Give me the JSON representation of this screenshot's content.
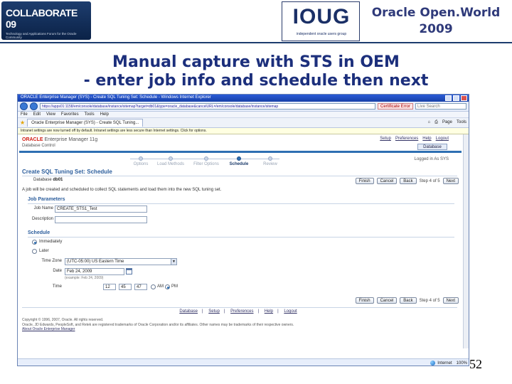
{
  "slide": {
    "title_line1": "Manual capture with STS in OEM",
    "title_line2": "- enter job info and schedule then next",
    "page_number": "52"
  },
  "banner": {
    "collaborate_logo": "COLLABORATE 09",
    "collaborate_tagline": "Technology and Applications Forum for the Oracle Community",
    "ioug_logo": "IOUG",
    "ioug_tagline": "independent oracle users group",
    "event_line1": "Oracle Open.World",
    "event_line2": "2009"
  },
  "browser": {
    "window_title": "ORACLE Enterprise Manager (SYS) - Create SQL Tuning Set: Schedule - Windows Internet Explorer",
    "url": "https://apps01:1158/em/console/database/instance/sitemap?target=db01&type=oracle_database&cancelURL=/em/console/database/instance/sitemap",
    "certificate_label": "Certificate Error",
    "search_placeholder": "Live Search",
    "menu": [
      "File",
      "Edit",
      "View",
      "Favorites",
      "Tools",
      "Help"
    ],
    "tab_label": "Oracle Enterprise Manager (SYS) - Create SQL Tuning...",
    "tools": [
      "Page",
      "Tools"
    ],
    "infobar": "Intranet settings are now turned off by default. Intranet settings are less secure than Internet settings. Click for options.",
    "status_zone": "Internet",
    "zoom": "100%"
  },
  "oem": {
    "brand_oracle": "ORACLE",
    "brand_product": "Enterprise Manager 11g",
    "brand_sub": "Database Control",
    "global_links": [
      "Setup",
      "Preferences",
      "Help",
      "Logout"
    ],
    "db_tab": "Database",
    "train_steps": [
      {
        "label": "Options",
        "current": false
      },
      {
        "label": "Load Methods",
        "current": false
      },
      {
        "label": "Filter Options",
        "current": false
      },
      {
        "label": "Schedule",
        "current": true
      },
      {
        "label": "Review",
        "current": false
      }
    ],
    "logged_in": "Logged in As SYS",
    "page_header": "Create SQL Tuning Set: Schedule",
    "database_label": "Database",
    "database_value": "db01",
    "buttons": {
      "finish": "Finish",
      "cancel": "Cancel",
      "back": "Back",
      "step": "Step 4 of 5",
      "next": "Next"
    },
    "intro": "A job will be created and scheduled to collect SQL statements and load them into the new SQL tuning set.",
    "job_section": "Job Parameters",
    "job_name_label": "Job Name",
    "job_name_value": "CREATE_STS1_Test",
    "description_label": "Description",
    "description_value": "",
    "schedule_section": "Schedule",
    "radio_immediately": "Immediately",
    "radio_later": "Later",
    "timezone_label": "Time Zone",
    "timezone_value": "(UTC-05:00) US Eastern Time",
    "date_label": "Date",
    "date_value": "Feb 24, 2009",
    "date_hint": "(example: Feb 24, 2009)",
    "time_label": "Time",
    "time_hour": "12",
    "time_min": "45",
    "time_sec": "47",
    "time_am": "AM",
    "time_pm": "PM",
    "footer_links": [
      "Database",
      "Setup",
      "Preferences",
      "Help",
      "Logout"
    ],
    "copyright_line1": "Copyright © 1996, 2007, Oracle. All rights reserved.",
    "copyright_line2": "Oracle, JD Edwards, PeopleSoft, and Retek are registered trademarks of Oracle Corporation and/or its affiliates. Other names may be trademarks of their respective owners.",
    "about_link": "About Oracle Enterprise Manager"
  }
}
